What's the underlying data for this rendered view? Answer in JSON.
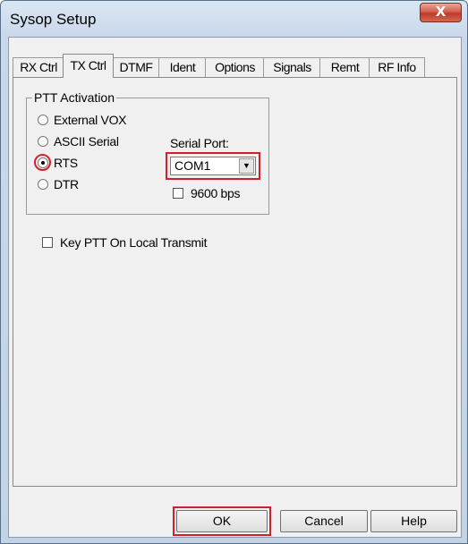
{
  "window": {
    "title": "Sysop Setup",
    "close_glyph": "X"
  },
  "tabs": [
    {
      "label": "RX Ctrl",
      "active": false
    },
    {
      "label": "TX Ctrl",
      "active": true
    },
    {
      "label": "DTMF",
      "active": false
    },
    {
      "label": "Ident",
      "active": false
    },
    {
      "label": "Options",
      "active": false
    },
    {
      "label": "Signals",
      "active": false
    },
    {
      "label": "Remt",
      "active": false
    },
    {
      "label": "RF Info",
      "active": false
    }
  ],
  "ptt_group": {
    "legend": "PTT Activation",
    "options": [
      {
        "label": "External VOX",
        "checked": false
      },
      {
        "label": "ASCII Serial",
        "checked": false
      },
      {
        "label": "RTS",
        "checked": true
      },
      {
        "label": "DTR",
        "checked": false
      }
    ],
    "serial_port_label": "Serial Port:",
    "serial_port_value": "COM1",
    "baud_label": "9600 bps",
    "baud_checked": false
  },
  "key_ptt_label": "Key PTT On Local Transmit",
  "key_ptt_checked": false,
  "buttons": {
    "ok": "OK",
    "cancel": "Cancel",
    "help": "Help"
  },
  "colors": {
    "highlight": "#d0202a",
    "dialog_bg": "#f0f0f0",
    "close_button": "#c0392b"
  }
}
